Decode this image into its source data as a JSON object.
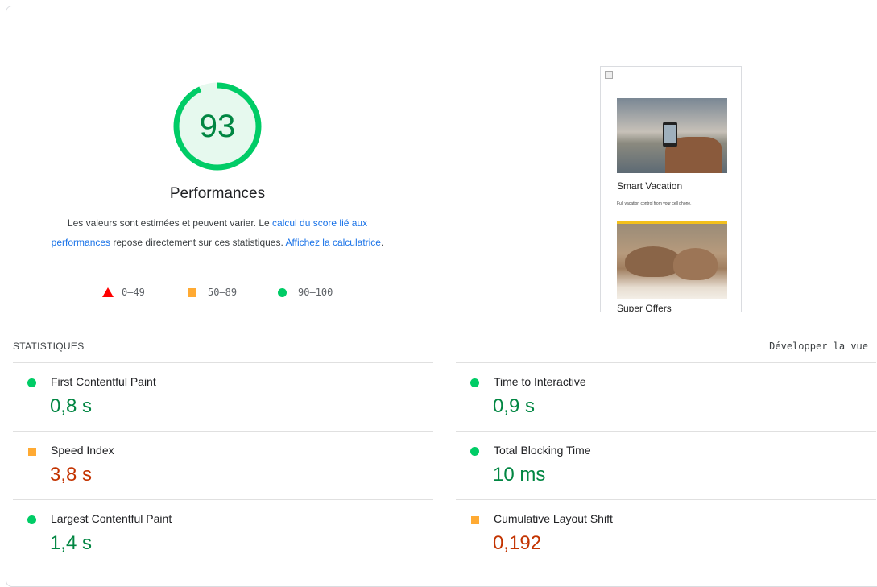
{
  "score": {
    "value": 93,
    "fraction": 0.93,
    "title": "Performances",
    "color": "#0c6"
  },
  "description": {
    "part1": "Les valeurs sont estimées et peuvent varier. Le ",
    "link1": "calcul du score lié aux performances",
    "part2": " repose directement sur ces statistiques. ",
    "link2": "Affichez la calculatrice",
    "part3": "."
  },
  "legend": [
    {
      "icon": "red-triangle-icon",
      "range": "0–49",
      "color": "#f00"
    },
    {
      "icon": "orange-square-icon",
      "range": "50–89",
      "color": "#fa3"
    },
    {
      "icon": "green-circle-icon",
      "range": "90–100",
      "color": "#0c6"
    }
  ],
  "screenshot": {
    "card1_title": "Smart Vacation",
    "card1_desc": "Full vacation control from your cell phone.",
    "card2_title": "Super Offers"
  },
  "stats": {
    "heading": "STATISTIQUES",
    "expand_label": "Développer la vue",
    "metrics": [
      {
        "name": "First Contentful Paint",
        "value": "0,8 s",
        "status": "good"
      },
      {
        "name": "Time to Interactive",
        "value": "0,9 s",
        "status": "good"
      },
      {
        "name": "Speed Index",
        "value": "3,8 s",
        "status": "average"
      },
      {
        "name": "Total Blocking Time",
        "value": "10 ms",
        "status": "good"
      },
      {
        "name": "Largest Contentful Paint",
        "value": "1,4 s",
        "status": "good"
      },
      {
        "name": "Cumulative Layout Shift",
        "value": "0,192",
        "status": "average"
      }
    ]
  },
  "colors": {
    "good": "#018642",
    "average": "#c33300",
    "link": "#1a73e8"
  }
}
